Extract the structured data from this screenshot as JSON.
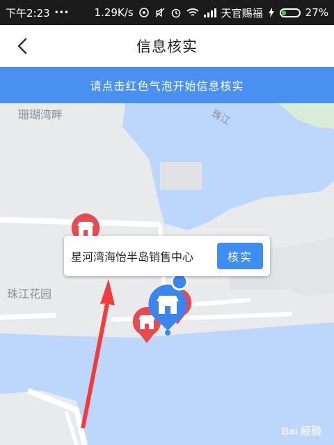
{
  "status_bar": {
    "time": "下午2:23",
    "dots": "•••",
    "speed": "1.29K/s",
    "carrier": "天官赐福",
    "battery": "27%",
    "battery_level": 0.27,
    "icons": [
      "sync-icon",
      "mute-icon",
      "alarm-icon",
      "wifi-icon",
      "signal-icon",
      "charging-icon"
    ]
  },
  "header": {
    "title": "信息核实",
    "back_icon": "chevron-left-icon"
  },
  "banner": {
    "text": "请点击红色气泡开始信息核实"
  },
  "map": {
    "labels": {
      "shanhu": "珊瑚湾畔",
      "zhujiang": "珠江",
      "garden": "珠江花园"
    },
    "colors": {
      "water": "#bcd7fb",
      "land": "#e9eaeb",
      "road": "#ffffff",
      "park": "#d8edd8"
    },
    "callout": {
      "text": "星河湾海怡半岛销售中心",
      "button": "核实"
    },
    "pins": {
      "red_color": "#e84a4f",
      "blue_color": "#3a86ec"
    },
    "annotation_arrow_color": "#f23b3b",
    "watermark": "Bai 经验"
  }
}
